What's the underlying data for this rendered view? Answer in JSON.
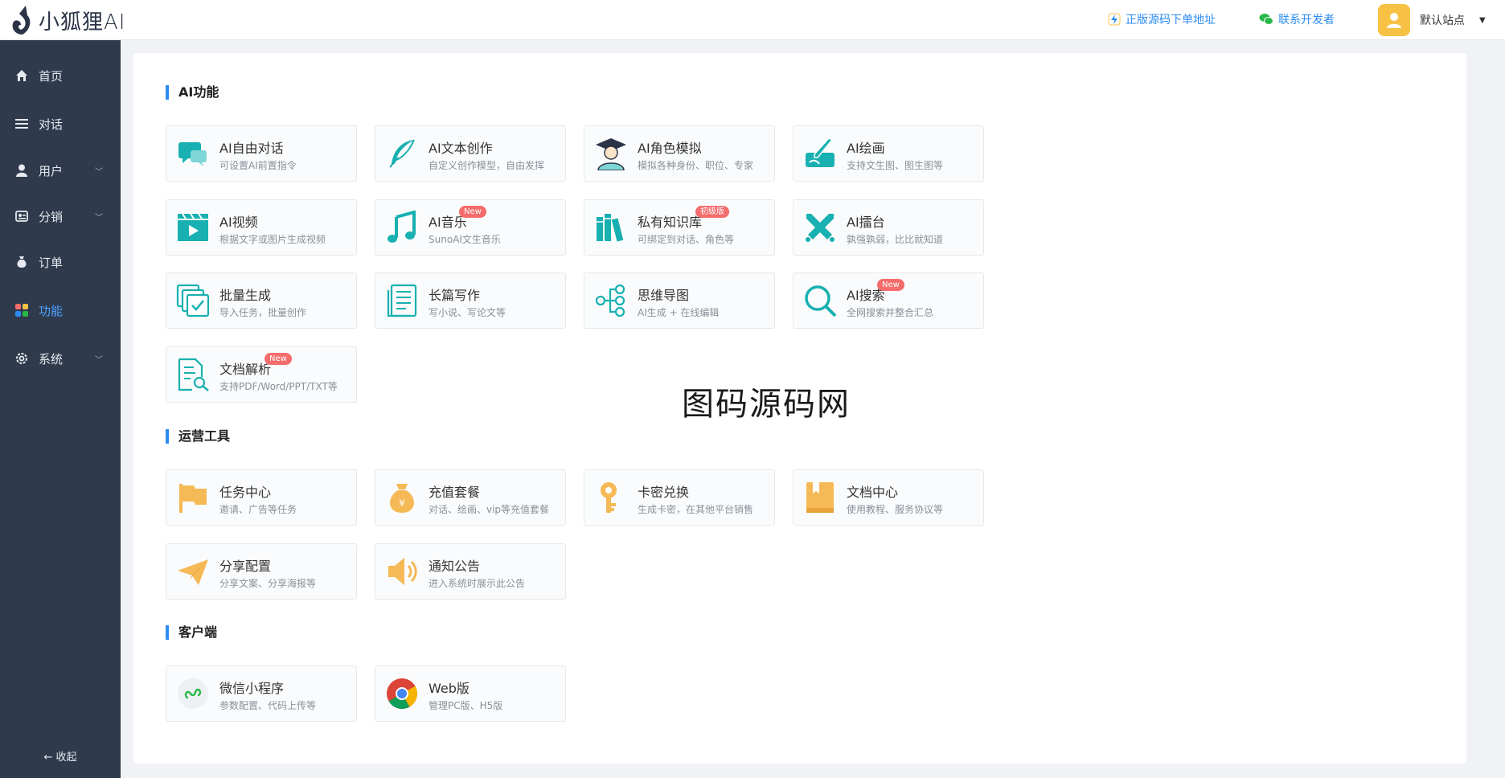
{
  "header": {
    "app_name": "小狐狸AI",
    "link_source": "正版源码下单地址",
    "link_contact": "联系开发者",
    "site_name": "默认站点"
  },
  "sidebar": {
    "items": [
      {
        "label": "首页",
        "icon": "home-icon"
      },
      {
        "label": "对话",
        "icon": "list-icon"
      },
      {
        "label": "用户",
        "icon": "user-icon"
      },
      {
        "label": "分销",
        "icon": "distribution-icon"
      },
      {
        "label": "订单",
        "icon": "order-icon"
      },
      {
        "label": "功能",
        "icon": "apps-icon"
      },
      {
        "label": "系统",
        "icon": "gear-icon"
      }
    ],
    "collapse_label": "收起"
  },
  "sections": {
    "ai": {
      "title": "AI功能",
      "tiles": [
        {
          "title": "AI自由对话",
          "sub": "可设置AI前置指令",
          "icon": "chat-icon"
        },
        {
          "title": "AI文本创作",
          "sub": "自定义创作模型，自由发挥",
          "icon": "feather-icon"
        },
        {
          "title": "AI角色模拟",
          "sub": "模拟各种身份、职位、专家",
          "icon": "graduate-icon"
        },
        {
          "title": "AI绘画",
          "sub": "支持文生图、图生图等",
          "icon": "paint-icon"
        },
        {
          "title": "AI视频",
          "sub": "根据文字或图片生成视频",
          "icon": "video-icon"
        },
        {
          "title": "AI音乐",
          "sub": "SunoAI文生音乐",
          "icon": "music-icon",
          "badge": "New"
        },
        {
          "title": "私有知识库",
          "sub": "可绑定到对话、角色等",
          "icon": "books-icon",
          "badge": "初级版"
        },
        {
          "title": "AI擂台",
          "sub": "孰强孰弱，比比就知道",
          "icon": "swords-icon"
        },
        {
          "title": "批量生成",
          "sub": "导入任务，批量创作",
          "icon": "batch-icon"
        },
        {
          "title": "长篇写作",
          "sub": "写小说、写论文等",
          "icon": "document-icon"
        },
        {
          "title": "思维导图",
          "sub": "AI生成 + 在线编辑",
          "icon": "mindmap-icon"
        },
        {
          "title": "AI搜索",
          "sub": "全网搜索并整合汇总",
          "icon": "search-icon",
          "badge": "New"
        },
        {
          "title": "文档解析",
          "sub": "支持PDF/Word/PPT/TXT等",
          "icon": "doc-search-icon",
          "badge": "New"
        }
      ]
    },
    "ops": {
      "title": "运营工具",
      "tiles": [
        {
          "title": "任务中心",
          "sub": "邀请、广告等任务",
          "icon": "flag-icon"
        },
        {
          "title": "充值套餐",
          "sub": "对话、绘画、vip等充值套餐",
          "icon": "money-bag-icon"
        },
        {
          "title": "卡密兑换",
          "sub": "生成卡密，在其他平台销售",
          "icon": "key-icon"
        },
        {
          "title": "文档中心",
          "sub": "使用教程、服务协议等",
          "icon": "book-icon"
        },
        {
          "title": "分享配置",
          "sub": "分享文案、分享海报等",
          "icon": "paper-plane-icon"
        },
        {
          "title": "通知公告",
          "sub": "进入系统时展示此公告",
          "icon": "speaker-icon"
        }
      ]
    },
    "client": {
      "title": "客户端",
      "tiles": [
        {
          "title": "微信小程序",
          "sub": "参数配置、代码上传等",
          "icon": "miniprogram-icon"
        },
        {
          "title": "Web版",
          "sub": "管理PC版、H5版",
          "icon": "chrome-icon"
        }
      ]
    }
  },
  "watermark": "图码源码网",
  "colors": {
    "teal": "#18b0b0",
    "orange": "#f5b955",
    "sidebar": "#2f3a4d",
    "accent": "#2d8cf0",
    "badge": "#f56c6c"
  }
}
